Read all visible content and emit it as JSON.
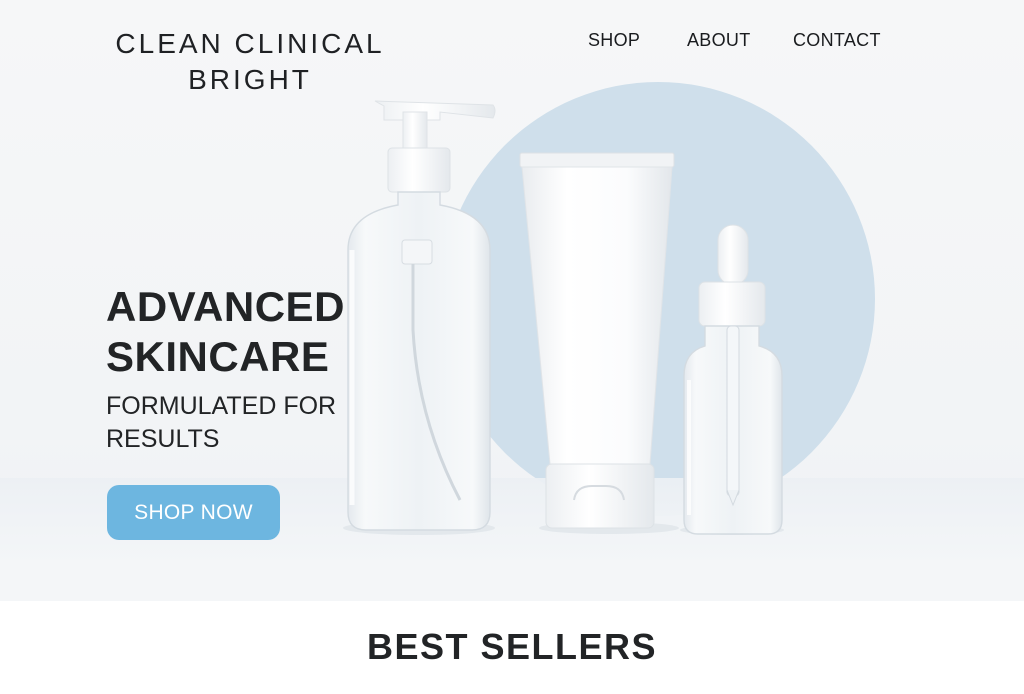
{
  "brand": {
    "line1": "CLEAN CLINICAL",
    "line2": "BRIGHT"
  },
  "nav": {
    "items": [
      {
        "label": "SHOP"
      },
      {
        "label": "ABOUT"
      },
      {
        "label": "CONTACT"
      }
    ]
  },
  "hero": {
    "headline_line1": "ADVANCED",
    "headline_line2": "SKINCARE",
    "subline_line1": "FORMULATED FOR",
    "subline_line2": "RESULTS",
    "cta_label": "SHOP NOW"
  },
  "products_image": {
    "items": [
      "pump-bottle",
      "white-tube",
      "dropper-bottle"
    ]
  },
  "sections": {
    "best_sellers_title": "BEST SELLERS"
  },
  "colors": {
    "accent": "#6db6e0",
    "circle": "#cfdfeb",
    "text": "#222426"
  }
}
